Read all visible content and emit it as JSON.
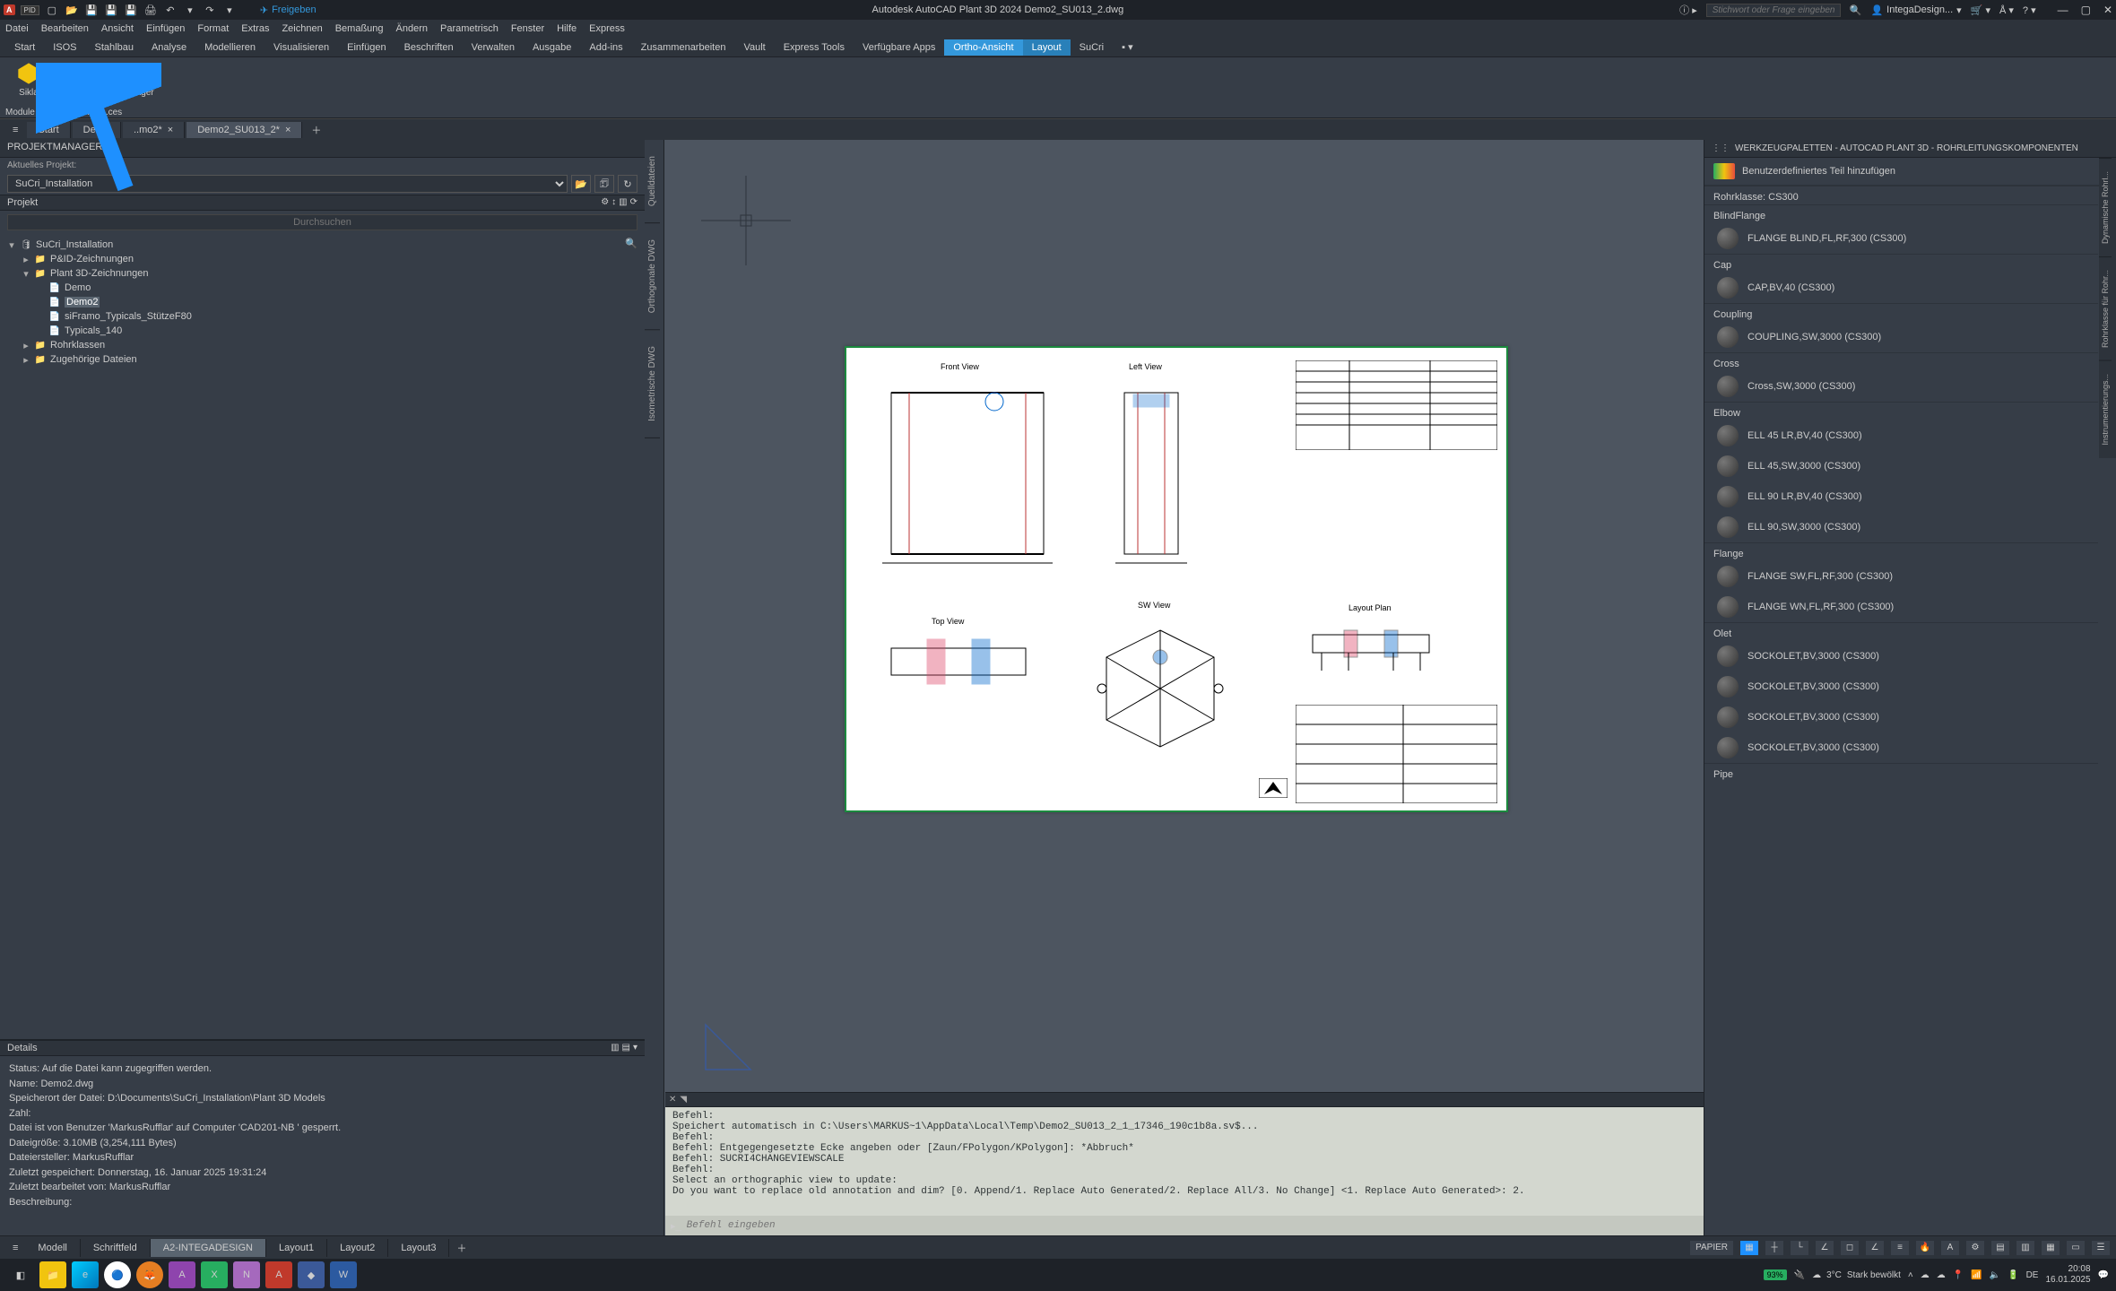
{
  "title_bar": {
    "share": "Freigeben",
    "center": "Autodesk AutoCAD Plant 3D 2024   Demo2_SU013_2.dwg",
    "search_placeholder": "Stichwort oder Frage eingeben",
    "user": "IntegaDesign..."
  },
  "menu": [
    "Datei",
    "Bearbeiten",
    "Ansicht",
    "Einfügen",
    "Format",
    "Extras",
    "Zeichnen",
    "Bemaßung",
    "Ändern",
    "Parametrisch",
    "Fenster",
    "Hilfe",
    "Express"
  ],
  "ribbon_tabs": [
    "Start",
    "ISOS",
    "Stahlbau",
    "Analyse",
    "Modellieren",
    "Visualisieren",
    "Einfügen",
    "Beschriften",
    "Verwalten",
    "Ausgabe",
    "Add-ins",
    "Zusammenarbeiten",
    "Vault",
    "Express Tools",
    "Verfügbare Apps",
    "Ortho-Ansicht",
    "Layout",
    "SuCri"
  ],
  "ribbon_active": [
    "Ortho-Ansicht",
    "Layout"
  ],
  "ribbon_buttons": {
    "sikla": "Sikla",
    "sucri": "SuCri-Manager",
    "third": "Manager"
  },
  "module_row": [
    "Module 2",
    "Module 4",
    "...ces"
  ],
  "file_tabs": [
    "Start",
    "Demo",
    "..mo2*",
    "Demo2_SU013_2*"
  ],
  "file_tab_active": "Demo2_SU013_2*",
  "proj": {
    "header": "PROJEKTMANAGER",
    "curr_label": "Aktuelles Projekt:",
    "selected": "SuCri_Installation",
    "section": "Projekt",
    "search_placeholder": "Durchsuchen",
    "tree": {
      "root": "SuCri_Installation",
      "pnid": "P&ID-Zeichnungen",
      "plant3d": "Plant 3D-Zeichnungen",
      "demo": "Demo",
      "demo2": "Demo2",
      "siframo": "siFramo_Typicals_StützeF80",
      "typicals": "Typicals_140",
      "rohr": "Rohrklassen",
      "zug": "Zugehörige Dateien"
    },
    "details_header": "Details",
    "details": {
      "l1": "Status: Auf die Datei kann zugegriffen werden.",
      "l2": "Name: Demo2.dwg",
      "l3": "Speicherort der Datei: D:\\Documents\\SuCri_Installation\\Plant 3D Models",
      "l4": "Zahl:",
      "l5": "Datei ist von Benutzer 'MarkusRufflar' auf Computer 'CAD201-NB ' gesperrt.",
      "l6": "Dateigröße: 3.10MB (3,254,111 Bytes)",
      "l7": "Dateiersteller:  MarkusRufflar",
      "l8": "Zuletzt gespeichert: Donnerstag, 16. Januar 2025 19:31:24",
      "l9": "Zuletzt bearbeitet von:  MarkusRufflar",
      "l10": "Beschreibung:"
    }
  },
  "canvas_vtabs": [
    "Quelldateien",
    "Orthogonale DWG",
    "Isometrische DWG"
  ],
  "sheet": {
    "front": "Front View",
    "left": "Left View",
    "top": "Top View",
    "sw": "SW View",
    "layout": "Layout Plan"
  },
  "cmd": {
    "log": "Befehl:\nSpeichert automatisch in C:\\Users\\MARKUS~1\\AppData\\Local\\Temp\\Demo2_SU013_2_1_17346_190c1b8a.sv$...\nBefehl:\nBefehl: Entgegengesetzte Ecke angeben oder [Zaun/FPolygon/KPolygon]: *Abbruch*\nBefehl: SUCRI4CHANGEVIEWSCALE\nBefehl:\nSelect an orthographic view to update:\nDo you want to replace old annotation and dim? [0. Append/1. Replace Auto Generated/2. Replace All/3. No Change] <1. Replace Auto Generated>: 2.",
    "placeholder": "Befehl eingeben"
  },
  "palette": {
    "header": "WERKZEUGPALETTEN - AUTOCAD PLANT 3D - ROHRLEITUNGSKOMPONENTEN",
    "add": "Benutzerdefiniertes Teil hinzufügen",
    "rohrklasse": "Rohrklasse: CS300",
    "side_tabs": [
      "Dynamische Rohrl...",
      "Rohrklasse für Rohr...",
      "Instrumentierungs..."
    ],
    "groups": {
      "blindflange": {
        "label": "BlindFlange",
        "items": [
          "FLANGE BLIND,FL,RF,300 (CS300)"
        ]
      },
      "cap": {
        "label": "Cap",
        "items": [
          "CAP,BV,40 (CS300)"
        ]
      },
      "coupling": {
        "label": "Coupling",
        "items": [
          "COUPLING,SW,3000 (CS300)"
        ]
      },
      "cross": {
        "label": "Cross",
        "items": [
          "Cross,SW,3000 (CS300)"
        ]
      },
      "elbow": {
        "label": "Elbow",
        "items": [
          "ELL 45 LR,BV,40 (CS300)",
          "ELL 45,SW,3000 (CS300)",
          "ELL 90 LR,BV,40 (CS300)",
          "ELL 90,SW,3000 (CS300)"
        ]
      },
      "flange": {
        "label": "Flange",
        "items": [
          "FLANGE SW,FL,RF,300 (CS300)",
          "FLANGE WN,FL,RF,300 (CS300)"
        ]
      },
      "olet": {
        "label": "Olet",
        "items": [
          "SOCKOLET,BV,3000 (CS300)",
          "SOCKOLET,BV,3000 (CS300)",
          "SOCKOLET,BV,3000 (CS300)",
          "SOCKOLET,BV,3000 (CS300)"
        ]
      },
      "pipe": {
        "label": "Pipe",
        "items": []
      }
    }
  },
  "layout_tabs": [
    "Modell",
    "Schriftfeld",
    "A2-INTEGADESIGN",
    "Layout1",
    "Layout2",
    "Layout3"
  ],
  "layout_active": "A2-INTEGADESIGN",
  "status_right": {
    "paper": "PAPIER"
  },
  "taskbar": {
    "battery": "93%",
    "temp": "3°C",
    "weather": "Stark bewölkt",
    "time": "20:08",
    "date": "16.01.2025"
  }
}
